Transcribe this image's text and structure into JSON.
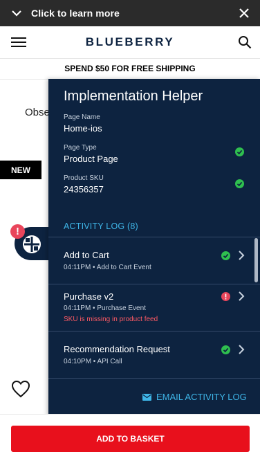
{
  "banner": {
    "label": "Click to learn more"
  },
  "header": {
    "brand": "BLUEBERRY"
  },
  "promo": {
    "text": "SPEND $50 FOR FREE SHIPPING"
  },
  "product": {
    "title_fragment": "Obse",
    "badge": "NEW"
  },
  "launcher": {
    "alert_glyph": "!"
  },
  "helper": {
    "title": "Implementation Helper",
    "fields": [
      {
        "label": "Page Name",
        "value": "Home-ios",
        "status": ""
      },
      {
        "label": "Page Type",
        "value": "Product Page",
        "status": "ok"
      },
      {
        "label": "Product SKU",
        "value": "24356357",
        "status": "ok"
      }
    ],
    "activity_title": "ACTIVITY LOG (8)",
    "log": [
      {
        "name": "Add to Cart",
        "meta": "04:11PM  •  Add to Cart Event",
        "status": "ok",
        "error": ""
      },
      {
        "name": "Purchase v2",
        "meta": "04:11PM  •  Purchase Event",
        "status": "error",
        "error": "SKU is missing in product feed"
      },
      {
        "name": "Recommendation Request",
        "meta": "04:10PM  •  API Call",
        "status": "ok",
        "error": ""
      }
    ],
    "email_label": "EMAIL ACTIVITY LOG"
  },
  "basket": {
    "label": "ADD TO BASKET"
  },
  "colors": {
    "panel_bg": "#0d2340",
    "accent": "#3fb6e8",
    "ok": "#2fbf4f",
    "error": "#e9455b",
    "basket": "#e8101c"
  }
}
